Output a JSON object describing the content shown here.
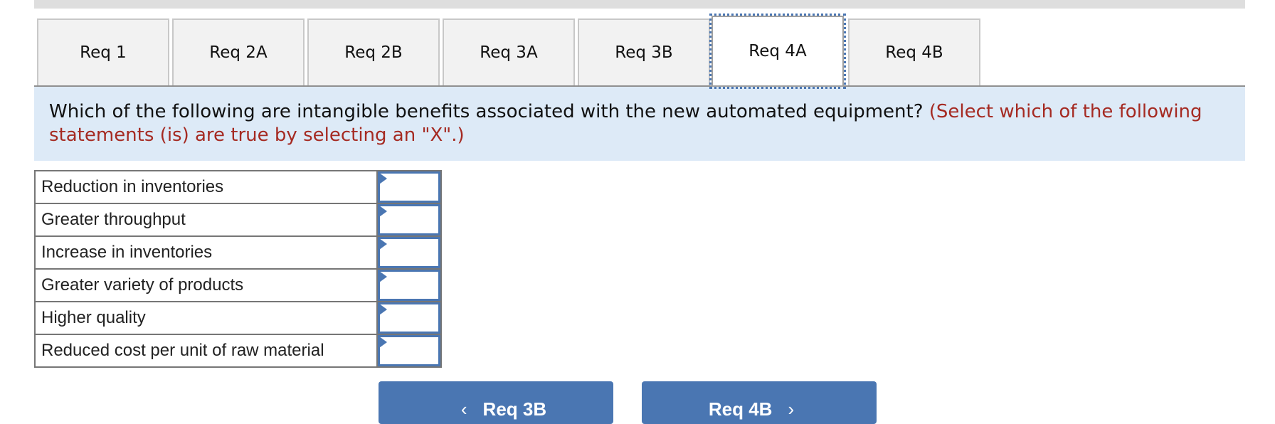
{
  "tabs": [
    {
      "label": "Req 1",
      "active": false
    },
    {
      "label": "Req 2A",
      "active": false
    },
    {
      "label": "Req 2B",
      "active": false
    },
    {
      "label": "Req 3A",
      "active": false
    },
    {
      "label": "Req 3B",
      "active": false
    },
    {
      "label": "Req 4A",
      "active": true
    },
    {
      "label": "Req 4B",
      "active": false
    }
  ],
  "question": {
    "text": "Which of the following are intangible benefits associated with the new automated equipment?",
    "instruction": "(Select which of the following statements (is) are true by selecting an \"X\".)"
  },
  "statements": [
    {
      "label": "Reduction in inventories",
      "value": ""
    },
    {
      "label": "Greater throughput",
      "value": ""
    },
    {
      "label": "Increase in inventories",
      "value": ""
    },
    {
      "label": "Greater variety of products",
      "value": ""
    },
    {
      "label": "Higher quality",
      "value": ""
    },
    {
      "label": "Reduced cost per unit of raw material",
      "value": ""
    }
  ],
  "navigation": {
    "prev": {
      "label": "Req 3B",
      "icon": "chevron-left-icon",
      "glyph": "‹"
    },
    "next": {
      "label": "Req 4B",
      "icon": "chevron-right-icon",
      "glyph": "›"
    }
  },
  "colors": {
    "accent": "#4a76b2",
    "instruction": "#a52a22",
    "panel_bg": "#ddeaf7"
  }
}
